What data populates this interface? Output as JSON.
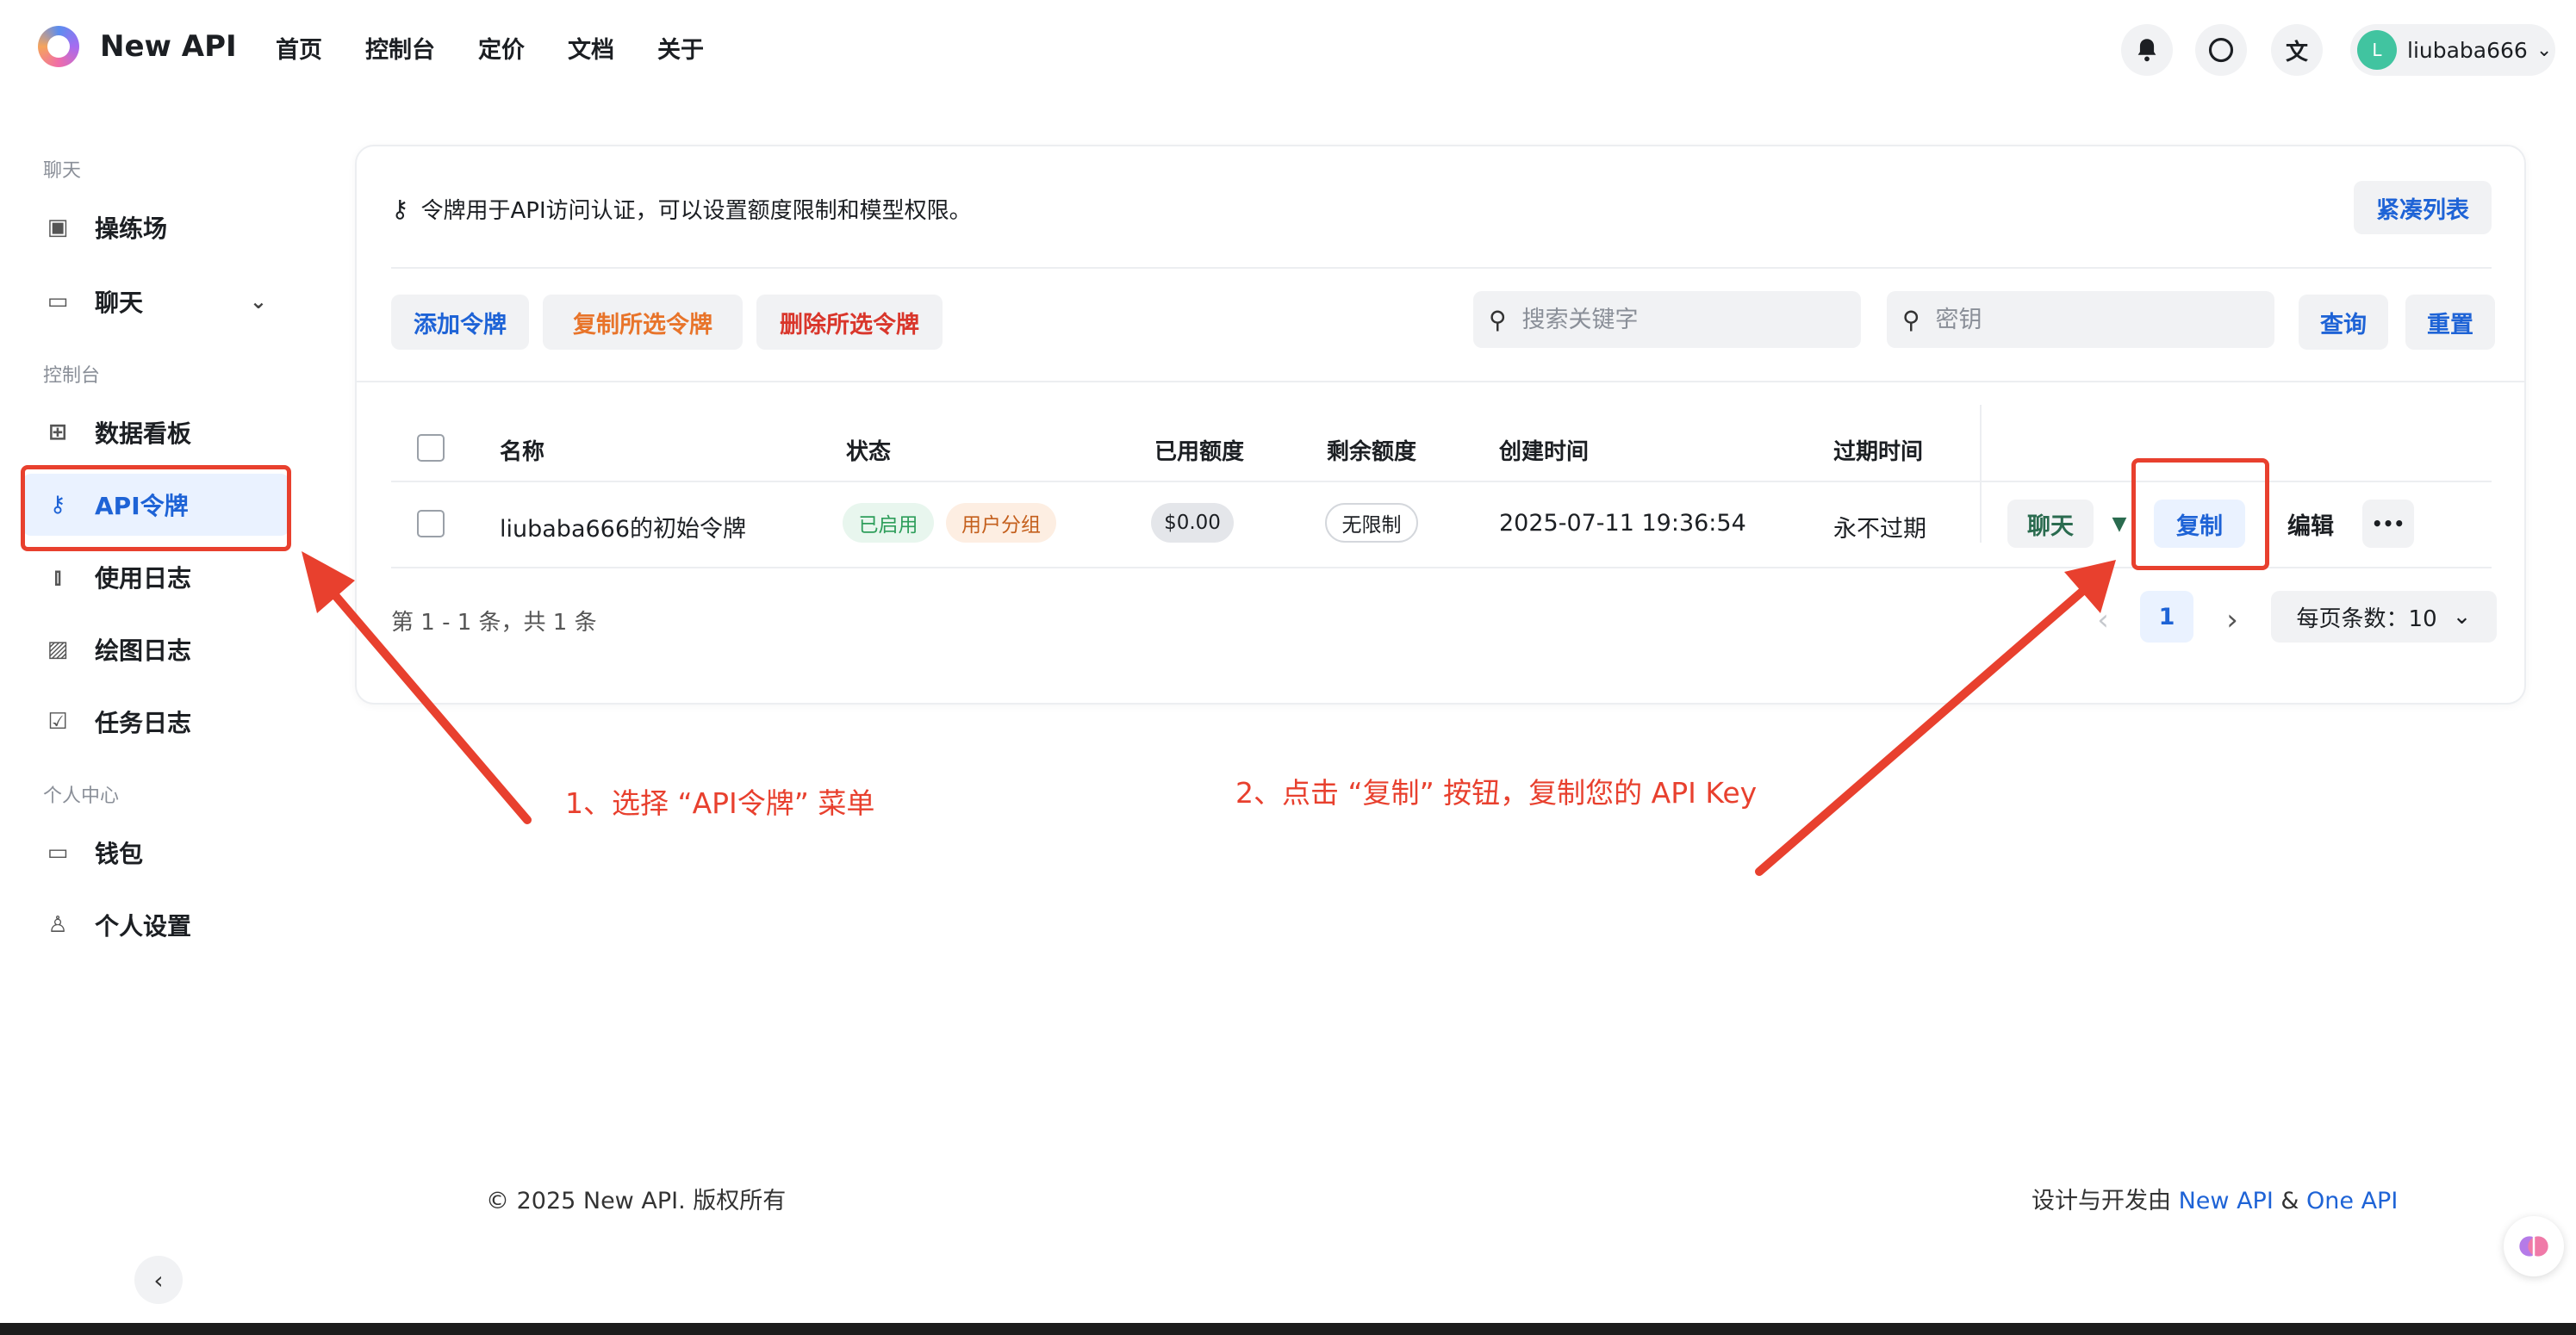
{
  "header": {
    "brand": "New API",
    "nav": [
      "首页",
      "控制台",
      "定价",
      "文档",
      "关于"
    ],
    "icons": [
      "bell-icon",
      "moon-icon",
      "translate-icon"
    ],
    "user": {
      "avatar": "L",
      "name": "liubaba666"
    }
  },
  "sidebar": {
    "section_chat": "聊天",
    "item_playground": "操练场",
    "item_chat": "聊天",
    "section_console": "控制台",
    "item_dashboard": "数据看板",
    "item_tokens": "API令牌",
    "item_usage_log": "使用日志",
    "item_drawing_log": "绘图日志",
    "item_task_log": "任务日志",
    "section_personal": "个人中心",
    "item_wallet": "钱包",
    "item_settings": "个人设置"
  },
  "card": {
    "info_text": "令牌用于API访问认证，可以设置额度限制和模型权限。",
    "compact_button": "紧凑列表",
    "add_button": "添加令牌",
    "copy_selected_button": "复制所选令牌",
    "delete_selected_button": "删除所选令牌",
    "search_keyword_placeholder": "搜索关键字",
    "search_key_placeholder": "密钥",
    "query_button": "查询",
    "reset_button": "重置"
  },
  "table": {
    "headers": {
      "name": "名称",
      "status": "状态",
      "used": "已用额度",
      "remaining": "剩余额度",
      "created": "创建时间",
      "expires": "过期时间"
    },
    "row": {
      "name": "liubaba666的初始令牌",
      "status": "已启用",
      "group": "用户分组",
      "used": "$0.00",
      "remaining": "无限制",
      "created": "2025-07-11 19:36:54",
      "expires": "永不过期",
      "actions": {
        "chat": "聊天",
        "copy": "复制",
        "edit": "编辑",
        "more": "•••"
      }
    }
  },
  "pagination": {
    "summary": "第 1 - 1 条，共 1 条",
    "current_page": "1",
    "page_size_label": "每页条数：10"
  },
  "footer": {
    "copyright": "© 2025 New API. 版权所有",
    "credit_prefix": "设计与开发由 ",
    "credit_link1": "New API",
    "credit_and": " & ",
    "credit_link2": "One API"
  },
  "annotations": {
    "step1": "1、选择 “API令牌” 菜单",
    "step2": "2、点击 “复制” 按钮，复制您的 API Key",
    "color": "#e8402e"
  },
  "colors": {
    "accent": "#1e63d6",
    "orange": "#e8742a",
    "red": "#d9362b",
    "success": "#2e9e5b"
  }
}
